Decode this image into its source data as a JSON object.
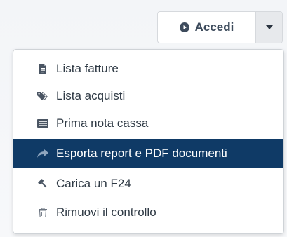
{
  "header": {
    "accedi_label": "Accedi"
  },
  "menu": {
    "items": [
      {
        "label": "Lista fatture",
        "icon": "document-icon"
      },
      {
        "label": "Lista acquisti",
        "icon": "tags-icon"
      },
      {
        "label": "Prima nota cassa",
        "icon": "list-icon"
      },
      {
        "label": "Esporta report e PDF documenti",
        "icon": "share-arrow-icon",
        "active": true
      },
      {
        "label": "Carica un F24",
        "icon": "gavel-icon"
      },
      {
        "label": "Rimuovi il controllo",
        "icon": "trash-icon"
      }
    ]
  },
  "colors": {
    "active_bg": "#0f3a66",
    "text": "#2f3a45",
    "icon": "#4a5563",
    "accent_button_text": "#3d4b5c"
  }
}
